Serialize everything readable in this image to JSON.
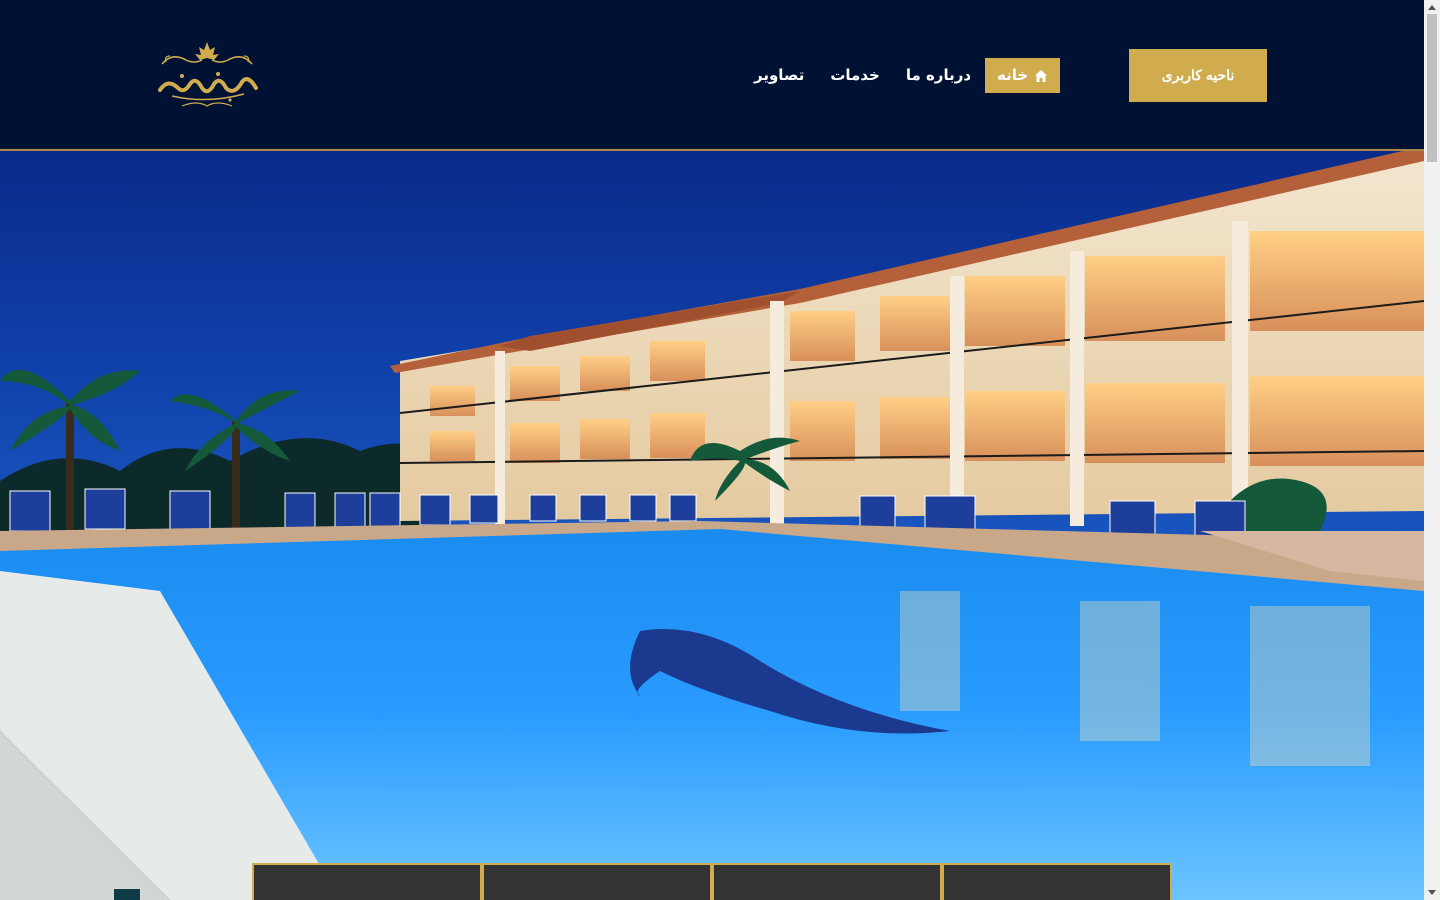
{
  "brand": {
    "logo_text": "هتل رسپینا",
    "accent_color": "#d1ac4f",
    "header_bg": "#001233"
  },
  "nav": {
    "items": [
      {
        "label": "خانه",
        "icon": "home-icon",
        "active": true
      },
      {
        "label": "درباره ما",
        "active": false
      },
      {
        "label": "خدمات",
        "active": false
      },
      {
        "label": "تصاویر",
        "active": false
      }
    ]
  },
  "header": {
    "user_area_label": "ناحیه کاربری"
  },
  "hero": {
    "image": "hotel-pool-night-photo"
  },
  "feature_boxes": [
    {},
    {},
    {},
    {}
  ]
}
